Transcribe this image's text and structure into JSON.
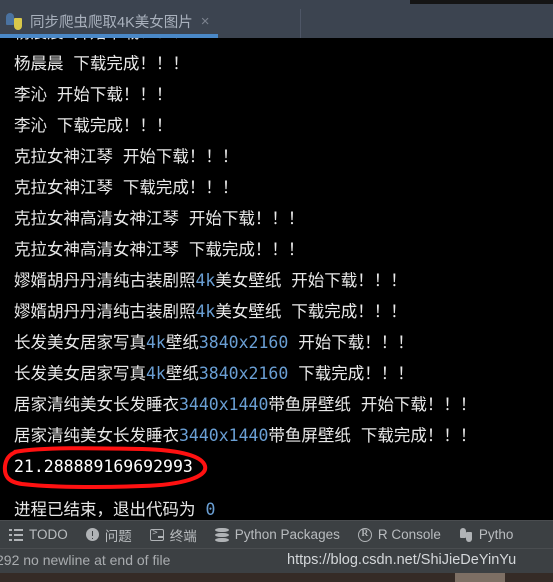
{
  "window": {
    "tab": {
      "title": "同步爬虫爬取4K美女图片",
      "close_label": "×",
      "icon": "python-file-icon",
      "active": true,
      "accent_color": "#4a88c7"
    }
  },
  "console": {
    "background_color": "#000000",
    "text_color": "#e8e8e8",
    "number_color": "#6a9fd4",
    "lines": [
      {
        "segments": [
          {
            "t": "杨晨晨  开始下载！！！",
            "k": "text"
          }
        ],
        "clipped": true
      },
      {
        "segments": [
          {
            "t": "杨晨晨  下载完成！！！",
            "k": "text"
          }
        ]
      },
      {
        "segments": [
          {
            "t": "李沁  开始下载！！！",
            "k": "text"
          }
        ]
      },
      {
        "segments": [
          {
            "t": "李沁  下载完成！！！",
            "k": "text"
          }
        ]
      },
      {
        "segments": [
          {
            "t": "克拉女神江琴  开始下载！！！",
            "k": "text"
          }
        ]
      },
      {
        "segments": [
          {
            "t": "克拉女神江琴  下载完成！！！",
            "k": "text"
          }
        ]
      },
      {
        "segments": [
          {
            "t": "克拉女神高清女神江琴  开始下载！！！",
            "k": "text"
          }
        ]
      },
      {
        "segments": [
          {
            "t": "克拉女神高清女神江琴  下载完成！！！",
            "k": "text"
          }
        ]
      },
      {
        "segments": [
          {
            "t": "嫪婿胡丹丹清纯古装剧照",
            "k": "text"
          },
          {
            "t": "4k",
            "k": "num"
          },
          {
            "t": "美女壁纸  开始下载！！！",
            "k": "text"
          }
        ]
      },
      {
        "segments": [
          {
            "t": "嫪婿胡丹丹清纯古装剧照",
            "k": "text"
          },
          {
            "t": "4k",
            "k": "num"
          },
          {
            "t": "美女壁纸  下载完成！！！",
            "k": "text"
          }
        ]
      },
      {
        "segments": [
          {
            "t": "长发美女居家写真",
            "k": "text"
          },
          {
            "t": "4k",
            "k": "num"
          },
          {
            "t": "壁纸",
            "k": "text"
          },
          {
            "t": "3840x2160",
            "k": "num"
          },
          {
            "t": "  开始下载！！！",
            "k": "text"
          }
        ]
      },
      {
        "segments": [
          {
            "t": "长发美女居家写真",
            "k": "text"
          },
          {
            "t": "4k",
            "k": "num"
          },
          {
            "t": "壁纸",
            "k": "text"
          },
          {
            "t": "3840x2160",
            "k": "num"
          },
          {
            "t": "  下载完成！！！",
            "k": "text"
          }
        ]
      },
      {
        "segments": [
          {
            "t": "居家清纯美女长发睡衣",
            "k": "text"
          },
          {
            "t": "3440x1440",
            "k": "num"
          },
          {
            "t": "带鱼屏壁纸  开始下载！！！",
            "k": "text"
          }
        ]
      },
      {
        "segments": [
          {
            "t": "居家清纯美女长发睡衣",
            "k": "text"
          },
          {
            "t": "3440x1440",
            "k": "num"
          },
          {
            "t": "带鱼屏壁纸  下载完成！！！",
            "k": "text"
          }
        ]
      },
      {
        "segments": [
          {
            "t": "21.288889169692993",
            "k": "text"
          }
        ],
        "highlighted": true
      },
      {
        "segments": [],
        "spacer": true
      },
      {
        "segments": [
          {
            "t": "进程已结束，退出代码为  ",
            "k": "text"
          },
          {
            "t": "0",
            "k": "num"
          }
        ]
      }
    ],
    "annotation": {
      "shape": "hand-drawn-ellipse",
      "color": "#ff1111",
      "targets_line": "21.288889169692993"
    }
  },
  "toolbar": {
    "items": [
      {
        "label": "TODO",
        "icon": "todo-list-icon"
      },
      {
        "label": "问题",
        "icon": "problems-warning-icon"
      },
      {
        "label": "终端",
        "icon": "terminal-icon"
      },
      {
        "label": "Python Packages",
        "icon": "packages-stack-icon"
      },
      {
        "label": "R Console",
        "icon": "r-console-icon"
      },
      {
        "label": "Pytho",
        "icon": "python-console-icon"
      }
    ]
  },
  "statusbar": {
    "left_text": "292 no newline at end of file",
    "url": "https://blog.csdn.net/ShiJieDeYinYu"
  }
}
